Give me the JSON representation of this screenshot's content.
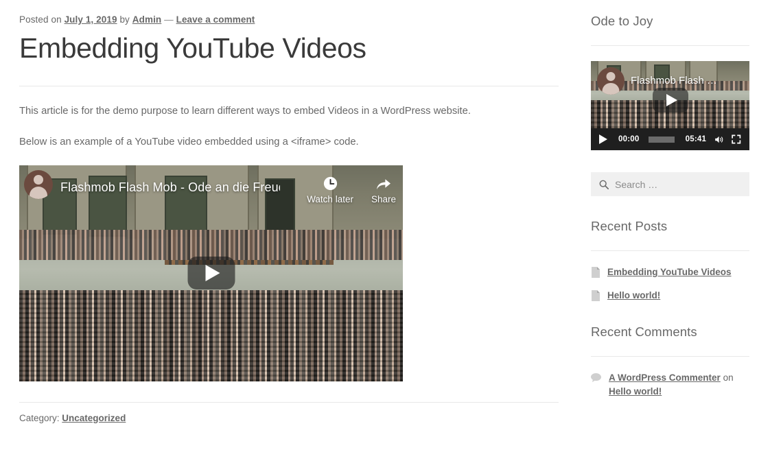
{
  "post": {
    "meta_posted_on": "Posted on",
    "meta_date": "July 1, 2019",
    "meta_by": "by",
    "meta_author": "Admin",
    "meta_sep": "—",
    "meta_comment_link": "Leave a comment",
    "title": "Embedding YouTube Videos",
    "paragraphs": [
      "This article is for the demo purpose to learn different ways to embed Videos in a WordPress website.",
      "Below is an example of a YouTube video embedded using a <iframe> code."
    ],
    "footer_label": "Category:",
    "footer_category": "Uncategorized"
  },
  "main_video": {
    "title": "Flashmob Flash Mob - Ode an die Freud…",
    "watch_later_label": "Watch later",
    "share_label": "Share",
    "clock_icon": "clock-icon",
    "share_icon": "share-icon",
    "play_icon": "play-icon",
    "avatar_icon": "channel-avatar"
  },
  "sidebar": {
    "video_widget": {
      "title": "Ode to Joy",
      "video_title": "Flashmob Flash …",
      "controls": {
        "play_icon": "play-icon",
        "current_time": "00:00",
        "duration": "05:41",
        "volume_icon": "volume-icon",
        "fullscreen_icon": "fullscreen-icon"
      }
    },
    "search": {
      "placeholder": "Search …",
      "value": "",
      "icon": "search-icon"
    },
    "recent_posts": {
      "title": "Recent Posts",
      "items": [
        {
          "label": "Embedding YouTube Videos",
          "icon": "document-icon"
        },
        {
          "label": "Hello world!",
          "icon": "document-icon"
        }
      ]
    },
    "recent_comments": {
      "title": "Recent Comments",
      "items": [
        {
          "icon": "comment-icon",
          "author": "A WordPress Commenter",
          "on": "on",
          "post": "Hello world!"
        }
      ]
    }
  },
  "colors": {
    "text": "#686868",
    "heading": "#3a3a3a",
    "rule": "#e8e8e8",
    "search_bg": "#f0f0f0",
    "player_bg": "#1f1f1f",
    "progress": "#6b6b6b",
    "avatar": "#6b4a3f"
  }
}
